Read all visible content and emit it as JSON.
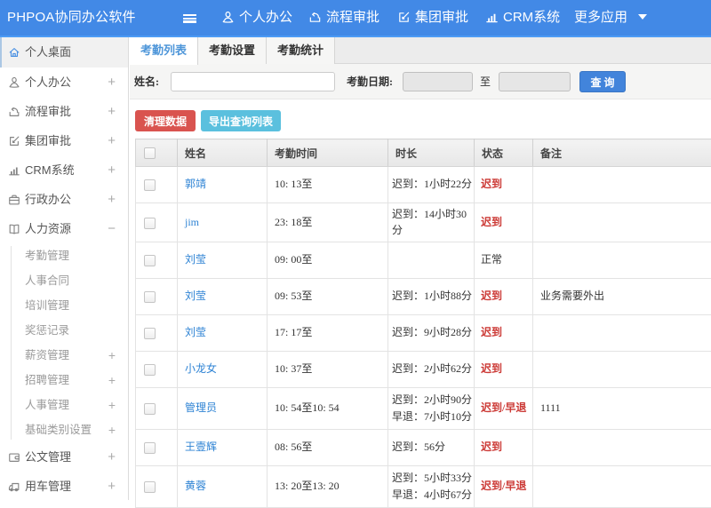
{
  "header": {
    "brand": "PHPOA协同办公软件",
    "nav": [
      {
        "label": "个人办公",
        "icon": "user-icon"
      },
      {
        "label": "流程审批",
        "icon": "workflow-icon"
      },
      {
        "label": "集团审批",
        "icon": "edit-icon"
      },
      {
        "label": "CRM系统",
        "icon": "barchart-icon"
      },
      {
        "label": "更多应用",
        "icon": "caret-down-icon"
      }
    ]
  },
  "sidebar": {
    "items_top": [
      {
        "label": "个人桌面",
        "icon": "home-icon",
        "active": true,
        "expander": ""
      },
      {
        "label": "个人办公",
        "icon": "user-icon",
        "expander": "+"
      },
      {
        "label": "流程审批",
        "icon": "workflow-icon",
        "expander": "+"
      },
      {
        "label": "集团审批",
        "icon": "edit-icon",
        "expander": "+"
      },
      {
        "label": "CRM系统",
        "icon": "barchart-icon",
        "expander": "+"
      },
      {
        "label": "行政办公",
        "icon": "briefcase-icon",
        "expander": "+"
      },
      {
        "label": "人力资源",
        "icon": "book-icon",
        "expander": "−"
      }
    ],
    "submenu": [
      {
        "label": "考勤管理",
        "expander": ""
      },
      {
        "label": "人事合同",
        "expander": ""
      },
      {
        "label": "培训管理",
        "expander": ""
      },
      {
        "label": "奖惩记录",
        "expander": ""
      },
      {
        "label": "薪资管理",
        "expander": "+"
      },
      {
        "label": "招聘管理",
        "expander": "+"
      },
      {
        "label": "人事管理",
        "expander": "+"
      },
      {
        "label": "基础类别设置",
        "expander": "+"
      }
    ],
    "items_bottom": [
      {
        "label": "公文管理",
        "icon": "wallet-icon",
        "expander": "+"
      },
      {
        "label": "用车管理",
        "icon": "truck-icon",
        "expander": "+"
      }
    ]
  },
  "tabs": [
    {
      "label": "考勤列表",
      "active": true
    },
    {
      "label": "考勤设置",
      "active": false
    },
    {
      "label": "考勤统计",
      "active": false
    }
  ],
  "filter": {
    "name_label": "姓名:",
    "date_label": "考勤日期:",
    "to_label": "至",
    "search_button": "查 询"
  },
  "toolbar": {
    "clear_button": "清理数据",
    "export_button": "导出查询列表"
  },
  "table": {
    "headers": [
      "姓名",
      "考勤时间",
      "时长",
      "状态",
      "备注"
    ],
    "rows": [
      {
        "name": "郭靖",
        "time": "10: 13至",
        "duration": [
          "迟到：1小时22分"
        ],
        "status": "迟到",
        "status_type": "late",
        "note": ""
      },
      {
        "name": "jim",
        "time": "23: 18至",
        "duration": [
          "迟到：14小时30分"
        ],
        "status": "迟到",
        "status_type": "late",
        "note": ""
      },
      {
        "name": "刘莹",
        "time": "09: 00至",
        "duration": [],
        "status": "正常",
        "status_type": "normal",
        "note": ""
      },
      {
        "name": "刘莹",
        "time": "09: 53至",
        "duration": [
          "迟到：1小时88分"
        ],
        "status": "迟到",
        "status_type": "late",
        "note": "业务需要外出"
      },
      {
        "name": "刘莹",
        "time": "17: 17至",
        "duration": [
          "迟到：9小时28分"
        ],
        "status": "迟到",
        "status_type": "late",
        "note": ""
      },
      {
        "name": "小龙女",
        "time": "10: 37至",
        "duration": [
          "迟到：2小时62分"
        ],
        "status": "迟到",
        "status_type": "late",
        "note": ""
      },
      {
        "name": "管理员",
        "time": "10: 54至10: 54",
        "duration": [
          "迟到：2小时90分",
          "早退：7小时10分"
        ],
        "status": "迟到/早退",
        "status_type": "late",
        "note": "1111"
      },
      {
        "name": "王壹辉",
        "time": "08: 56至",
        "duration": [
          "迟到：56分"
        ],
        "status": "迟到",
        "status_type": "late",
        "note": ""
      },
      {
        "name": "黄蓉",
        "time": "13: 20至13: 20",
        "duration": [
          "迟到：5小时33分",
          "早退：4小时67分"
        ],
        "status": "迟到/早退",
        "status_type": "late",
        "note": ""
      }
    ]
  }
}
